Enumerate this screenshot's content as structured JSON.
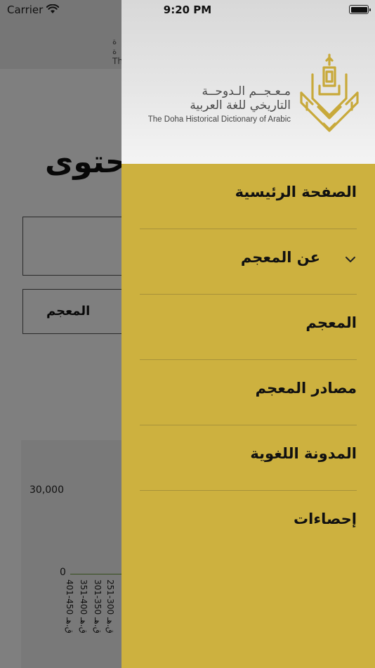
{
  "status_bar": {
    "carrier": "Carrier",
    "time": "9:20 PM"
  },
  "background": {
    "title_fragment": "حتوى",
    "field_label": "المعجم",
    "chart": {
      "y_ticks": [
        "30,000",
        "0"
      ],
      "x_labels": [
        "401-450 ق.هـ",
        "351-400 ق.هـ",
        "301-350 ق.هـ",
        "251-300 ق.هـ"
      ]
    }
  },
  "drawer": {
    "logo": {
      "arabic_line1": "مـعـجــم الـدوحــة",
      "arabic_line2": "التاريخي للغة العربية",
      "english": "The Doha Historical Dictionary of Arabic"
    },
    "menu": [
      {
        "label": "الصفحة الرئيسية",
        "has_submenu": false
      },
      {
        "label": "عن المعجم",
        "has_submenu": true
      },
      {
        "label": "المعجم",
        "has_submenu": false
      },
      {
        "label": "مصادر المعجم",
        "has_submenu": false
      },
      {
        "label": "المدونة اللغوية",
        "has_submenu": false
      },
      {
        "label": "إحصاءات",
        "has_submenu": false
      }
    ]
  },
  "colors": {
    "drawer_bg": "#cdb13f",
    "divider": "#a8923a",
    "emblem": "#c8a93a"
  }
}
